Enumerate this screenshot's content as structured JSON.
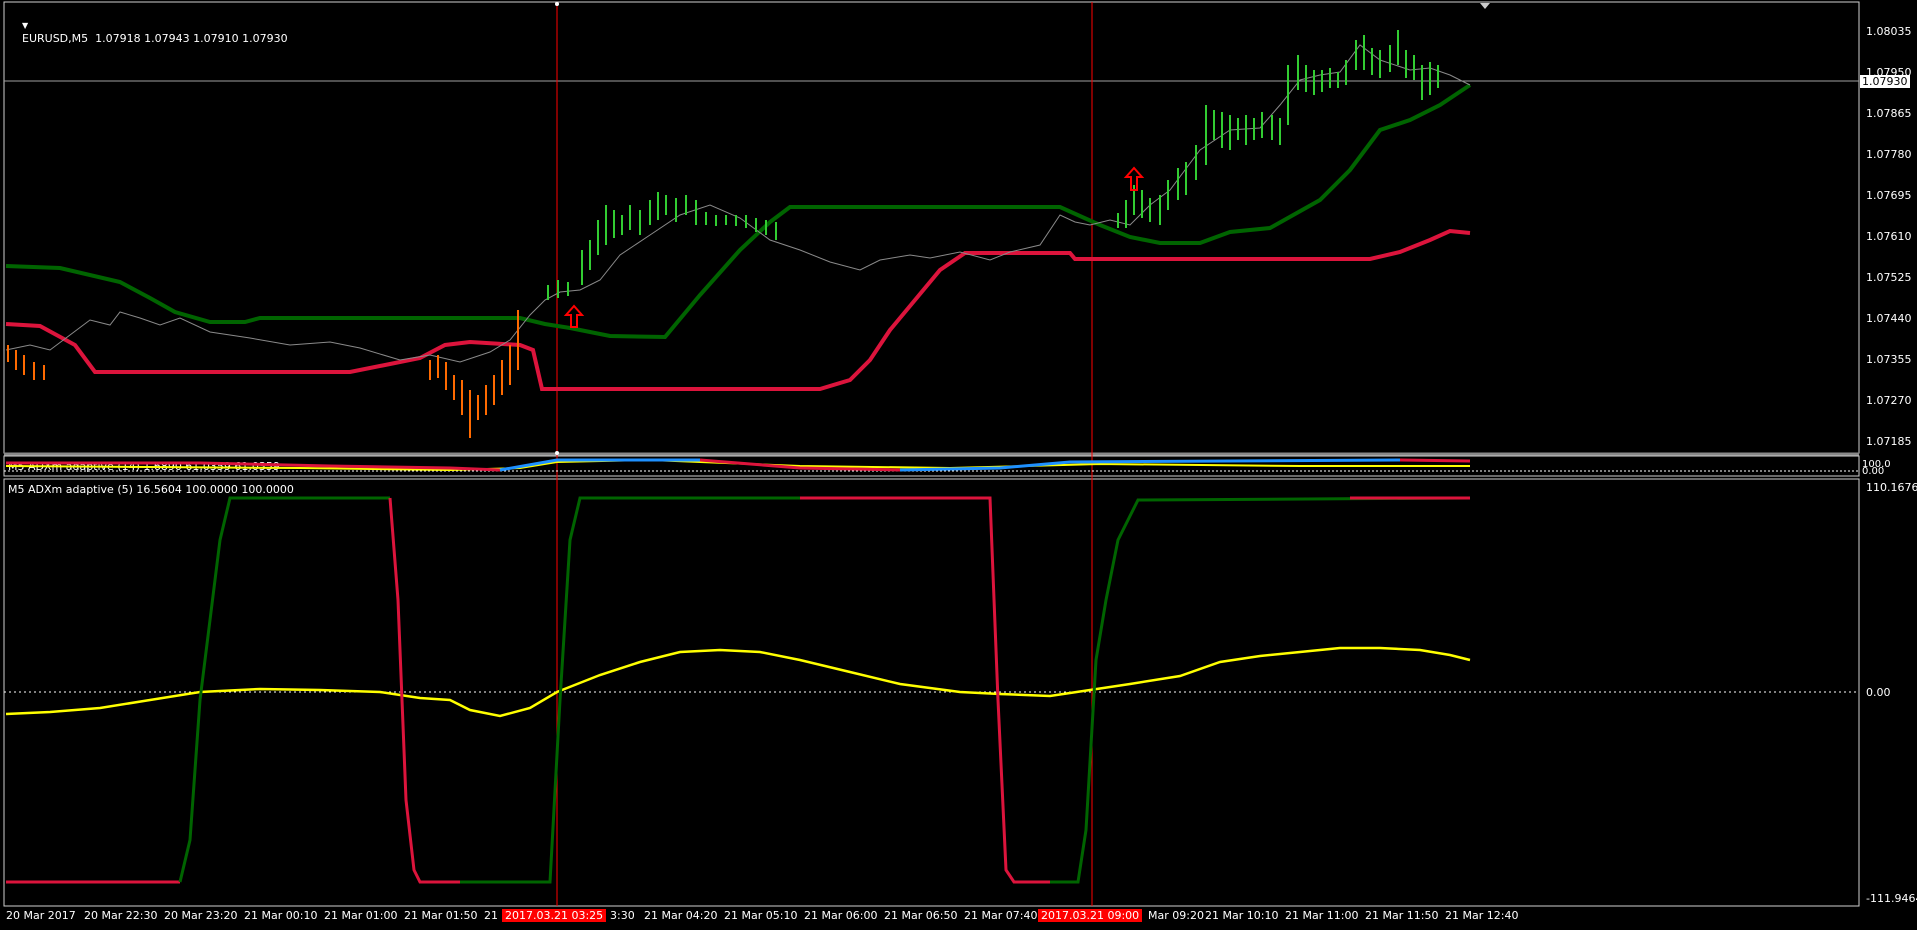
{
  "main_chart": {
    "title": "EURUSD,M5  1.07918 1.07943 1.07910 1.07930",
    "price_levels": [
      "1.08035",
      "1.07950",
      "1.07865",
      "1.07780",
      "1.07695",
      "1.07610",
      "1.07525",
      "1.07440",
      "1.07355",
      "1.07270",
      "1.07185"
    ],
    "current_price": "1.07930"
  },
  "indicator1": {
    "title": "M5 ADXm adaptive (14) 1.6890 61.0359 61.0359",
    "scale_labels": [
      "100.0",
      "0.00"
    ]
  },
  "indicator2": {
    "title": "M5 ADXm adaptive (5) 16.5604 100.0000 100.0000",
    "scale_labels": [
      "110.1676",
      "0.00",
      "-111.9464"
    ]
  },
  "time_axis": {
    "labels": [
      "20 Mar 2017",
      "20 Mar 22:30",
      "20 Mar 23:20",
      "21 Mar 00:10",
      "21 Mar 01:00",
      "21 Mar 01:50",
      "21",
      "3:30",
      "21 Mar 04:20",
      "21 Mar 05:10",
      "21 Mar 06:00",
      "21 Mar 06:50",
      "21 Mar 07:40",
      "Mar 09:20",
      "21 Mar 10:10",
      "21 Mar 11:00",
      "21 Mar 11:50",
      "21 Mar 12:40"
    ],
    "highlight_1": "2017.03.21 03:25",
    "highlight_2": "2017.03.21 09:00"
  },
  "colors": {
    "background": "#000000",
    "bull_bar": "#32cd32",
    "bear_bar": "#ff6a00",
    "upper_band": "#006400",
    "lower_band": "#dc143c",
    "adx_line": "#ffff00",
    "cursor_line": "#ff0000"
  },
  "icons": [
    "dropdown-triangle-icon",
    "buy-arrow-icon",
    "buy-arrow-icon"
  ]
}
